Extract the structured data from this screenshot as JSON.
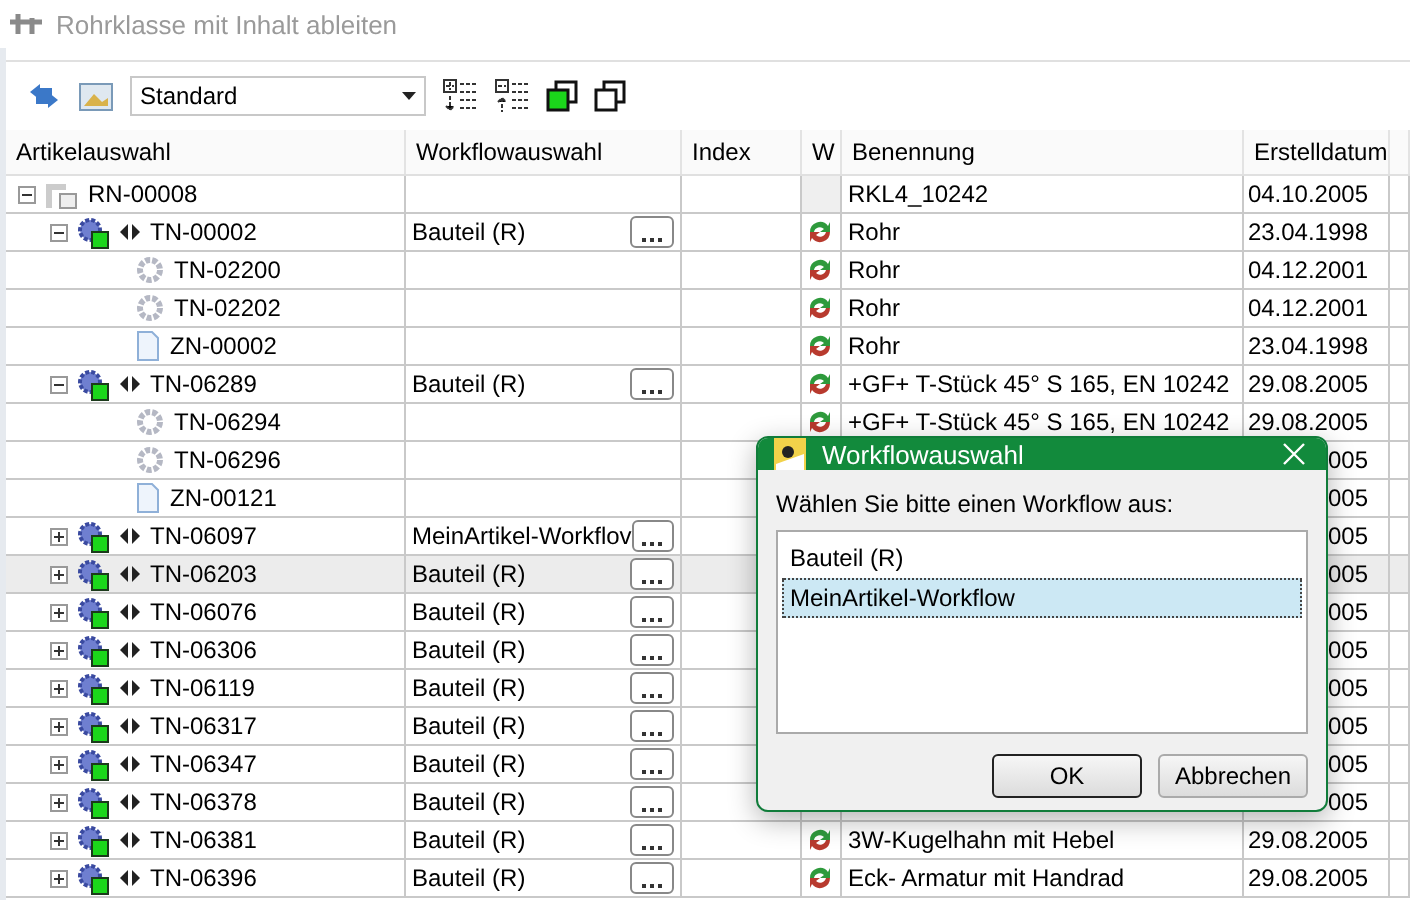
{
  "window": {
    "title": "Rohrklasse mit Inhalt ableiten"
  },
  "toolbar": {
    "view_select": {
      "value": "Standard"
    }
  },
  "table": {
    "columns": [
      "Artikelauswahl",
      "Workflowauswahl",
      "Index",
      "W",
      "Benennung",
      "Erstelldatum"
    ],
    "rows": [
      {
        "article": "RN-00008",
        "kind": "root",
        "expanded": true,
        "selected": false,
        "benennung": "RKL4_10242",
        "date": "04.10.2005",
        "children": [
          {
            "article": "TN-00002",
            "kind": "assembly",
            "expanded": true,
            "selected": false,
            "workflow": "Bauteil (R)",
            "sync": true,
            "benennung": "Rohr",
            "date": "23.04.1998",
            "children": [
              {
                "article": "TN-02200",
                "kind": "part",
                "selected": false,
                "sync": true,
                "benennung": "Rohr",
                "date": "04.12.2001"
              },
              {
                "article": "TN-02202",
                "kind": "part",
                "selected": false,
                "sync": true,
                "benennung": "Rohr",
                "date": "04.12.2001"
              },
              {
                "article": "ZN-00002",
                "kind": "drawing",
                "selected": false,
                "sync": true,
                "benennung": "Rohr",
                "date": "23.04.1998"
              }
            ]
          },
          {
            "article": "TN-06289",
            "kind": "assembly",
            "expanded": true,
            "selected": false,
            "workflow": "Bauteil (R)",
            "sync": true,
            "benennung": "+GF+ T-Stück 45° S 165, EN 10242",
            "date": "29.08.2005",
            "children": [
              {
                "article": "TN-06294",
                "kind": "part",
                "selected": false,
                "sync": true,
                "benennung": "+GF+ T-Stück 45° S 165, EN 10242",
                "date": "29.08.2005"
              },
              {
                "article": "TN-06296",
                "kind": "part",
                "selected": false,
                "date": "005"
              },
              {
                "article": "ZN-00121",
                "kind": "drawing",
                "selected": false,
                "date": "005"
              }
            ]
          },
          {
            "article": "TN-06097",
            "kind": "assembly",
            "expanded": false,
            "selected": false,
            "workflow": "MeinArtikel-Workflov",
            "date": "005"
          },
          {
            "article": "TN-06203",
            "kind": "assembly",
            "expanded": false,
            "selected": true,
            "workflow": "Bauteil (R)",
            "date": "005"
          },
          {
            "article": "TN-06076",
            "kind": "assembly",
            "expanded": false,
            "selected": false,
            "workflow": "Bauteil (R)",
            "date": "005"
          },
          {
            "article": "TN-06306",
            "kind": "assembly",
            "expanded": false,
            "selected": false,
            "workflow": "Bauteil (R)",
            "date": "005"
          },
          {
            "article": "TN-06119",
            "kind": "assembly",
            "expanded": false,
            "selected": false,
            "workflow": "Bauteil (R)",
            "date": "005"
          },
          {
            "article": "TN-06317",
            "kind": "assembly",
            "expanded": false,
            "selected": false,
            "workflow": "Bauteil (R)",
            "date": "005"
          },
          {
            "article": "TN-06347",
            "kind": "assembly",
            "expanded": false,
            "selected": false,
            "workflow": "Bauteil (R)",
            "date": "005"
          },
          {
            "article": "TN-06378",
            "kind": "assembly",
            "expanded": false,
            "selected": false,
            "workflow": "Bauteil (R)",
            "date": "005"
          },
          {
            "article": "TN-06381",
            "kind": "assembly",
            "expanded": false,
            "selected": false,
            "workflow": "Bauteil (R)",
            "sync": true,
            "benennung": "3W-Kugelhahn mit Hebel",
            "date": "29.08.2005"
          },
          {
            "article": "TN-06396",
            "kind": "assembly",
            "expanded": false,
            "selected": false,
            "workflow": "Bauteil (R)",
            "sync": true,
            "benennung": "Eck- Armatur mit Handrad",
            "date": "29.08.2005"
          }
        ]
      }
    ]
  },
  "dialog": {
    "title": "Workflowauswahl",
    "prompt": "Wählen Sie bitte einen Workflow aus:",
    "options": [
      {
        "label": "Bauteil (R)",
        "selected": false
      },
      {
        "label": "MeinArtikel-Workflow",
        "selected": true
      }
    ],
    "buttons": [
      {
        "label": "OK",
        "default": true
      },
      {
        "label": "Abbrechen",
        "default": false
      }
    ]
  }
}
